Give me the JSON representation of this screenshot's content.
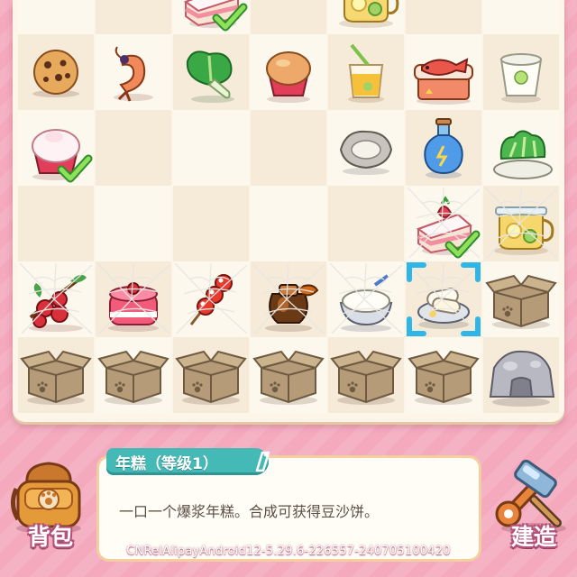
{
  "item_panel": {
    "title": "年糕（等级1）",
    "info_icon": "info-icon",
    "description": "一口一个爆浆年糕。合成可获得豆沙饼。"
  },
  "left_button": {
    "label": "背包",
    "icon": "backpack-icon"
  },
  "right_button": {
    "label": "建造",
    "icon": "hammer-wrench-icon"
  },
  "build_version": "CNRelAlipayAndroid12-5.29.6-226557-240705100420",
  "board": {
    "columns": 7,
    "rows": [
      [
        "macaron-cookie-icon",
        "mushroom-basket-icon",
        "strawberry-cake-slice-icon",
        "red-macaron-icon",
        "lemon-tea-pot-icon",
        "lotus-root-icon",
        ""
      ],
      [
        "chocolate-chip-cookie-icon",
        "shrimp-icon",
        "bok-choy-icon",
        "bread-muffin-icon",
        "juice-cup-icon",
        "fish-platter-icon",
        "yogurt-cup-icon"
      ],
      [
        "lychee-cupcake-icon",
        "",
        "",
        "",
        "oyster-icon",
        "potion-bottle-icon",
        "vegetable-plate-icon"
      ],
      [
        "",
        "",
        "",
        "",
        "",
        "strawberry-cake-slice-icon",
        "lemon-tea-pot-icon"
      ],
      [
        "hawthorn-branch-icon",
        "strawberry-mousse-icon",
        "candied-hawthorn-icon",
        "sauce-jar-icon",
        "rice-bowl-icon",
        "rice-cake-icon",
        "cardboard-box-icon"
      ],
      [
        "cardboard-box-icon",
        "cardboard-box-icon",
        "cardboard-box-icon",
        "cardboard-box-icon",
        "cardboard-box-icon",
        "cardboard-box-icon",
        "rock-icon"
      ]
    ],
    "cobwebbed": [
      [
        4,
        0
      ],
      [
        4,
        1
      ],
      [
        4,
        2
      ],
      [
        4,
        3
      ],
      [
        4,
        4
      ],
      [
        4,
        5
      ],
      [
        3,
        5
      ],
      [
        3,
        6
      ]
    ],
    "checked": [
      [
        0,
        2
      ],
      [
        2,
        0
      ],
      [
        3,
        5
      ]
    ],
    "selected": [
      4,
      5
    ]
  }
}
